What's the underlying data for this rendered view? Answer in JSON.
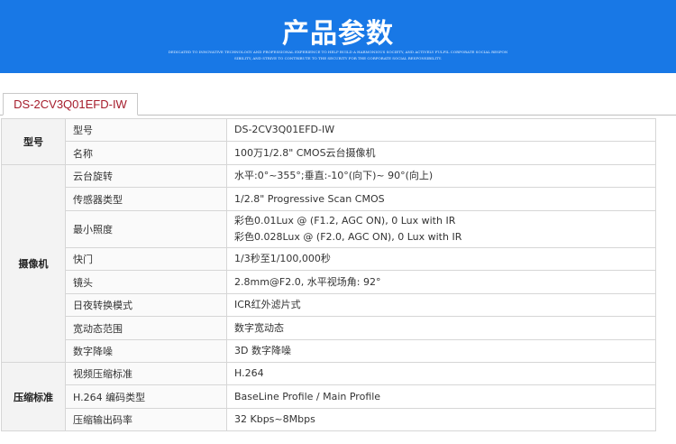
{
  "banner": {
    "title": "产品参数",
    "subtitle_line1": "DEDICATED TO INNOVATIVE TECHNOLOGY AND PROFESSIONAL EXPERIENCE TO HELP BUILD A HARMONIOUS SOCIETY, AND ACTIVELY FULFIL CORPORATE SOCIAL RESPON",
    "subtitle_line2": "SIBILITY, AND STRIVE TO CONTRIBUTE TO THE SECURITY FOR THE CORPORATE SOCIAL RESPONSIBILITY."
  },
  "model_tab": "DS-2CV3Q01EFD-IW",
  "groups": [
    {
      "name": "型号",
      "rows": [
        {
          "item": "型号",
          "value": [
            "DS-2CV3Q01EFD-IW"
          ]
        },
        {
          "item": "名称",
          "value": [
            "100万1/2.8\"  CMOS云台摄像机"
          ]
        }
      ]
    },
    {
      "name": "摄像机",
      "rows": [
        {
          "item": "云台旋转",
          "value": [
            "水平:0°~355°;垂直:-10°(向下)~ 90°(向上)"
          ]
        },
        {
          "item": "传感器类型",
          "value": [
            "1/2.8\" Progressive Scan CMOS"
          ]
        },
        {
          "item": "最小照度",
          "value": [
            "彩色0.01Lux @ (F1.2, AGC ON), 0 Lux with IR",
            "彩色0.028Lux @ (F2.0, AGC ON), 0 Lux with IR"
          ]
        },
        {
          "item": "快门",
          "value": [
            "1/3秒至1/100,000秒"
          ]
        },
        {
          "item": "镜头",
          "value": [
            "2.8mm@F2.0, 水平视场角: 92°"
          ]
        },
        {
          "item": "日夜转换模式",
          "value": [
            "ICR红外滤片式"
          ]
        },
        {
          "item": "宽动态范围",
          "value": [
            "数字宽动态"
          ]
        },
        {
          "item": "数字降噪",
          "value": [
            "3D 数字降噪"
          ]
        }
      ]
    },
    {
      "name": "压缩标准",
      "rows": [
        {
          "item": "视频压缩标准",
          "value": [
            "H.264"
          ]
        },
        {
          "item": "H.264 编码类型",
          "value": [
            "BaseLine Profile / Main Profile"
          ]
        },
        {
          "item": "压缩输出码率",
          "value": [
            "32 Kbps~8Mbps"
          ]
        }
      ]
    }
  ]
}
